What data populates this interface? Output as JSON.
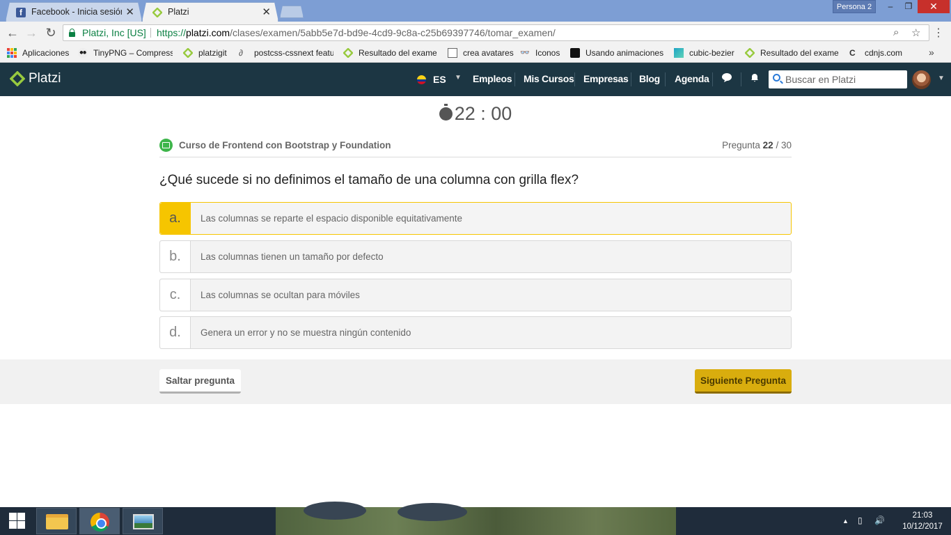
{
  "browser": {
    "tabs": [
      {
        "title": "Facebook - Inicia sesión o",
        "active": false
      },
      {
        "title": "Platzi",
        "active": true
      }
    ],
    "profile": "Persona 2",
    "window_controls": {
      "minimize": "–",
      "maximize": "❐",
      "close": "✕"
    },
    "security_label": "Platzi, Inc [US]",
    "url": {
      "scheme": "https://",
      "host": "platzi.com",
      "path": "/clases/examen/5abb5e7d-bd9e-4cd9-9c8a-c25b69397746/tomar_examen/"
    },
    "bookmarks": [
      {
        "label": "Aplicaciones",
        "icon": "apps-grid-icon"
      },
      {
        "label": "TinyPNG – Compress",
        "icon": "panda-icon"
      },
      {
        "label": "platzigit",
        "icon": "platzi-icon"
      },
      {
        "label": "postcss-cssnext featu",
        "icon": "postcss-icon"
      },
      {
        "label": "Resultado del exame",
        "icon": "platzi-icon"
      },
      {
        "label": "crea avatares",
        "icon": "page-icon"
      },
      {
        "label": "Iconos",
        "icon": "glasses-icon"
      },
      {
        "label": "Usando animaciones",
        "icon": "bird-icon"
      },
      {
        "label": "cubic-bezier",
        "icon": "curve-icon"
      },
      {
        "label": "Resultado del exame",
        "icon": "platzi-icon"
      },
      {
        "label": "cdnjs.com",
        "icon": "cdnjs-icon"
      }
    ],
    "bookmarks_more": "»"
  },
  "platzi_nav": {
    "brand": "Platzi",
    "language": "ES",
    "links": [
      "Empleos",
      "Mis Cursos",
      "Empresas",
      "Blog",
      "Agenda"
    ],
    "search_placeholder": "Buscar en Platzi"
  },
  "exam": {
    "timer": "22 : 00",
    "course": "Curso de Frontend con Bootstrap y Foundation",
    "question_prefix": "Pregunta",
    "question_current": "22",
    "question_total": "/ 30",
    "question": "¿Qué sucede si no definimos el tamaño de una columna con grilla flex?",
    "options": [
      {
        "letter": "a.",
        "text": "Las columnas se reparte el espacio disponible equitativamente",
        "selected": true
      },
      {
        "letter": "b.",
        "text": "Las columnas tienen un tamaño por defecto",
        "selected": false
      },
      {
        "letter": "c.",
        "text": "Las columnas se ocultan para móviles",
        "selected": false
      },
      {
        "letter": "d.",
        "text": "Genera un error y no se muestra ningún contenido",
        "selected": false
      }
    ],
    "skip_label": "Saltar pregunta",
    "next_label": "Siguiente Pregunta"
  },
  "taskbar": {
    "time": "21:03",
    "date": "10/12/2017"
  },
  "colors": {
    "navbar": "#1c3643",
    "platzi_green": "#98ca3f",
    "selected_option": "#f6c500",
    "next_button": "#d9ad0e",
    "secure_green": "#0b8043"
  }
}
